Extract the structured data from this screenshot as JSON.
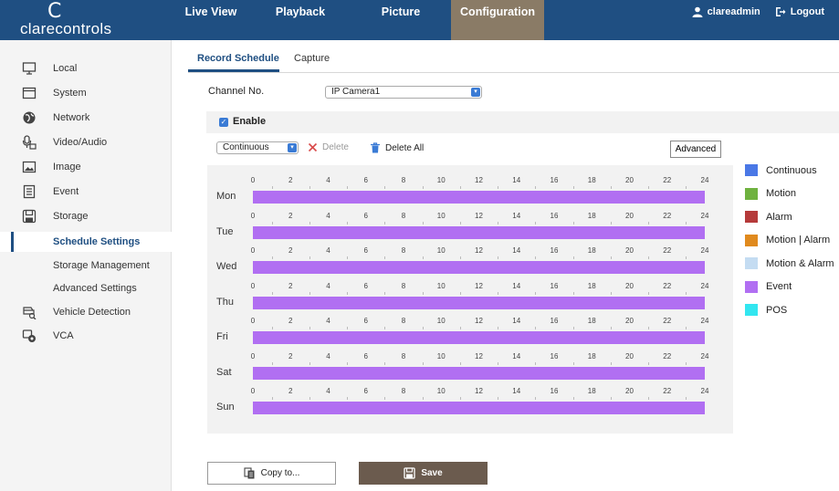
{
  "brand": {
    "mark": "C",
    "name": "clarecontrols"
  },
  "nav": [
    {
      "label": "Live View",
      "active": false
    },
    {
      "label": "Playback",
      "active": false
    },
    {
      "label": "Picture",
      "active": false
    },
    {
      "label": "Configuration",
      "active": true
    }
  ],
  "user": {
    "name": "clareadmin",
    "logout_label": "Logout"
  },
  "sidebar": {
    "items": [
      {
        "label": "Local",
        "icon": "monitor-icon"
      },
      {
        "label": "System",
        "icon": "system-icon"
      },
      {
        "label": "Network",
        "icon": "globe-icon"
      },
      {
        "label": "Video/Audio",
        "icon": "mic-camera-icon"
      },
      {
        "label": "Image",
        "icon": "image-icon"
      },
      {
        "label": "Event",
        "icon": "event-icon"
      },
      {
        "label": "Storage",
        "icon": "storage-icon"
      },
      {
        "label": "Schedule Settings",
        "icon": "",
        "selected": true
      },
      {
        "label": "Storage Management",
        "icon": ""
      },
      {
        "label": "Advanced Settings",
        "icon": ""
      },
      {
        "label": "Vehicle Detection",
        "icon": "vehicle-detection-icon"
      },
      {
        "label": "VCA",
        "icon": "vca-icon"
      }
    ]
  },
  "tabs": [
    {
      "label": "Record Schedule",
      "active": true
    },
    {
      "label": "Capture",
      "active": false
    }
  ],
  "channel": {
    "label": "Channel No.",
    "value": "IP Camera1"
  },
  "enable": {
    "label": "Enable",
    "checked": true
  },
  "toolbar": {
    "mode_value": "Continuous",
    "delete_label": "Delete",
    "delete_all_label": "Delete All",
    "advanced_label": "Advanced"
  },
  "schedule": {
    "hour_ticks": [
      "0",
      "2",
      "4",
      "6",
      "8",
      "10",
      "12",
      "14",
      "16",
      "18",
      "20",
      "22",
      "24"
    ],
    "days": [
      {
        "label": "Mon",
        "type": "Event",
        "start": 0,
        "end": 24
      },
      {
        "label": "Tue",
        "type": "Event",
        "start": 0,
        "end": 24
      },
      {
        "label": "Wed",
        "type": "Event",
        "start": 0,
        "end": 24
      },
      {
        "label": "Thu",
        "type": "Event",
        "start": 0,
        "end": 24
      },
      {
        "label": "Fri",
        "type": "Event",
        "start": 0,
        "end": 24
      },
      {
        "label": "Sat",
        "type": "Event",
        "start": 0,
        "end": 24
      },
      {
        "label": "Sun",
        "type": "Event",
        "start": 0,
        "end": 24
      }
    ]
  },
  "legend": [
    {
      "label": "Continuous",
      "color": "#4a78e6"
    },
    {
      "label": "Motion",
      "color": "#6fb23f"
    },
    {
      "label": "Alarm",
      "color": "#b53a3a"
    },
    {
      "label": "Motion | Alarm",
      "color": "#e08a1e"
    },
    {
      "label": "Motion & Alarm",
      "color": "#c4dcf2"
    },
    {
      "label": "Event",
      "color": "#b16ff2"
    },
    {
      "label": "POS",
      "color": "#32e6f0"
    }
  ],
  "buttons": {
    "copy_label": "Copy to...",
    "save_label": "Save"
  },
  "colors": {
    "header": "#1f4f82",
    "active_nav": "#8a7b66",
    "save_button": "#6b5b4e",
    "accent": "#3a7bd5"
  }
}
